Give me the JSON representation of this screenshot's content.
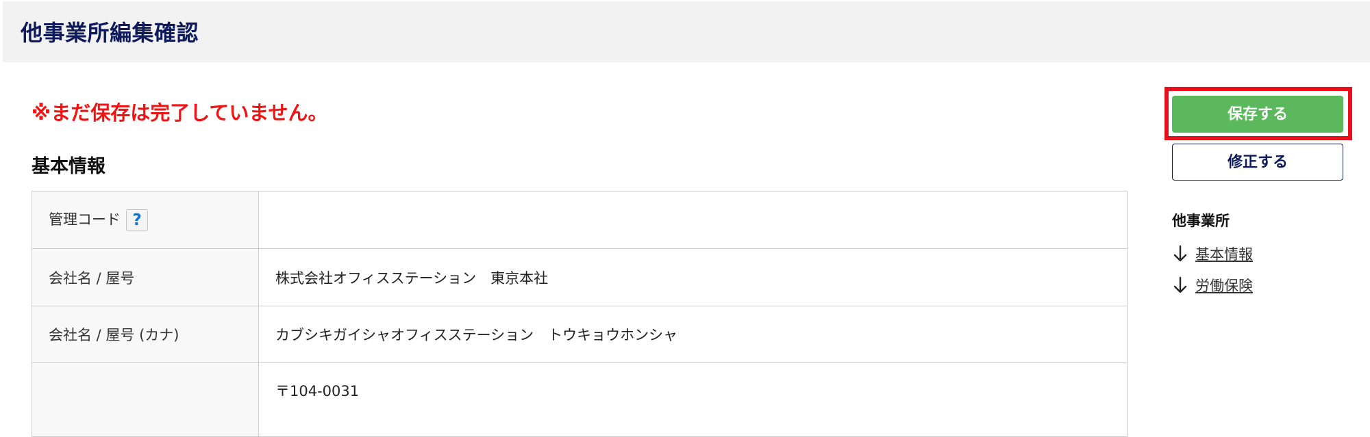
{
  "header": {
    "title": "他事業所編集確認"
  },
  "warning": {
    "text": "※まだ保存は完了していません。"
  },
  "basic_info": {
    "title": "基本情報",
    "rows": [
      {
        "label": "管理コード",
        "value": "",
        "has_help": true,
        "help_icon": "question-icon",
        "help_text": "?"
      },
      {
        "label": "会社名 / 屋号",
        "value": "株式会社オフィスステーション　東京本社"
      },
      {
        "label": "会社名 / 屋号 (カナ)",
        "value": "カブシキガイシャオフィスステーション　トウキョウホンシャ"
      },
      {
        "label": "",
        "value": "〒104-0031"
      }
    ]
  },
  "actions": {
    "save_label": "保存する",
    "edit_label": "修正する",
    "save_color": "#5cb85c",
    "highlight_color": "#e8101c"
  },
  "side_nav": {
    "title": "他事業所",
    "items": [
      {
        "label": "基本情報",
        "icon": "arrow-down-icon"
      },
      {
        "label": "労働保険",
        "icon": "arrow-down-icon"
      }
    ]
  },
  "colors": {
    "title_color": "#0f1a5c",
    "warning_color": "#f01414",
    "header_bg": "#f2f2f2"
  }
}
